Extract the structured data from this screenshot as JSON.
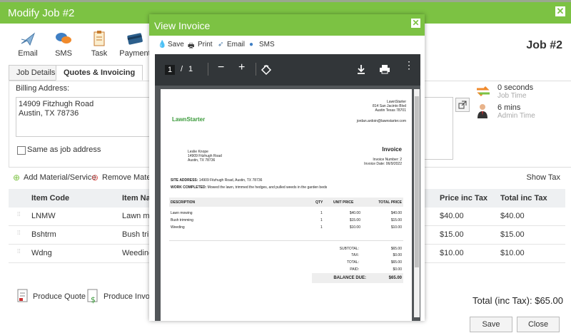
{
  "main": {
    "title": "Modify Job #2",
    "job_number": "Job #2",
    "toolbar": {
      "email": "Email",
      "sms": "SMS",
      "task": "Task",
      "payment": "Payment"
    },
    "tabs": [
      {
        "label": "Job Details"
      },
      {
        "label": "Quotes & Invoicing"
      }
    ],
    "billing_label": "Billing Address:",
    "billing_address_line1": "14909 Fitzhugh Road",
    "billing_address_line2": "Austin, TX 78736",
    "same_as_job": "Same as job address",
    "times": [
      {
        "value": "0 seconds",
        "label": "Job Time"
      },
      {
        "value": "6 mins",
        "label": "Admin Time"
      }
    ],
    "add_material": "Add Material/Service",
    "remove_material": "Remove Materia",
    "show_tax": "Show Tax",
    "columns": {
      "code": "Item Code",
      "name": "Item Na",
      "price": "Price inc Tax",
      "total": "Total inc Tax"
    },
    "rows": [
      {
        "code": "LNMW",
        "name": "Lawn mo",
        "price": "$40.00",
        "total": "$40.00"
      },
      {
        "code": "Bshtrm",
        "name": "Bush trir",
        "price": "$15.00",
        "total": "$15.00"
      },
      {
        "code": "Wdng",
        "name": "Weeding",
        "price": "$10.00",
        "total": "$10.00"
      }
    ],
    "produce_quote": "Produce Quote",
    "produce_invoice": "Produce Invoice",
    "total": "Total (inc Tax): $65.00",
    "save": "Save",
    "close": "Close"
  },
  "invoice_dialog": {
    "title": "View Invoice",
    "toolbar": {
      "save": "Save",
      "print": "Print",
      "email": "Email",
      "sms": "SMS"
    },
    "pdf": {
      "page_current": "1",
      "page_sep": "/",
      "page_total": "1"
    },
    "doc": {
      "company": "LawnStarter",
      "company_name": "LawnStarter",
      "company_address1": "814 San Jacinto Blvd",
      "company_address2": "Austin Texas 78701",
      "company_email": "jordan.ardoin@lawnstarter.com",
      "client_name": "Leslie Knope",
      "client_address1": "14909 Fitzhugh Road",
      "client_address2": "Austin, TX 78736",
      "invoice_heading": "Invoice",
      "invoice_number": "Invoice Number: 2",
      "invoice_date": "Invoice Date: 06/9/2022",
      "site_label": "SITE ADDRESS:",
      "site_value": "14909 Fitzhugh Road, Austin, TX 78736",
      "work_label": "WORK COMPLETED:",
      "work_value": "Mowed the lawn, trimmed the hedges, and pulled weeds in the garden beds",
      "columns": {
        "desc": "DESCRIPTION",
        "qty": "QTY",
        "unit": "UNIT PRICE",
        "total": "TOTAL PRICE"
      },
      "lines": [
        {
          "desc": "Lawn mowing",
          "qty": "1",
          "unit": "$40.00",
          "total": "$40.00"
        },
        {
          "desc": "Bush trimming",
          "qty": "1",
          "unit": "$15.00",
          "total": "$15.00"
        },
        {
          "desc": "Weeding",
          "qty": "1",
          "unit": "$10.00",
          "total": "$10.00"
        }
      ],
      "subtotal_label": "SUBTOTAL:",
      "subtotal": "$65.00",
      "tax_label": "TAX:",
      "tax": "$0.00",
      "total_label": "TOTAL:",
      "total": "$65.00",
      "paid_label": "PAID:",
      "paid": "$0.00",
      "balance_label": "BALANCE DUE:",
      "balance": "$65.00"
    }
  },
  "colors": {
    "brand_green": "#7cc243",
    "pdf_toolbar": "#323639",
    "pdf_bg": "#525659"
  }
}
